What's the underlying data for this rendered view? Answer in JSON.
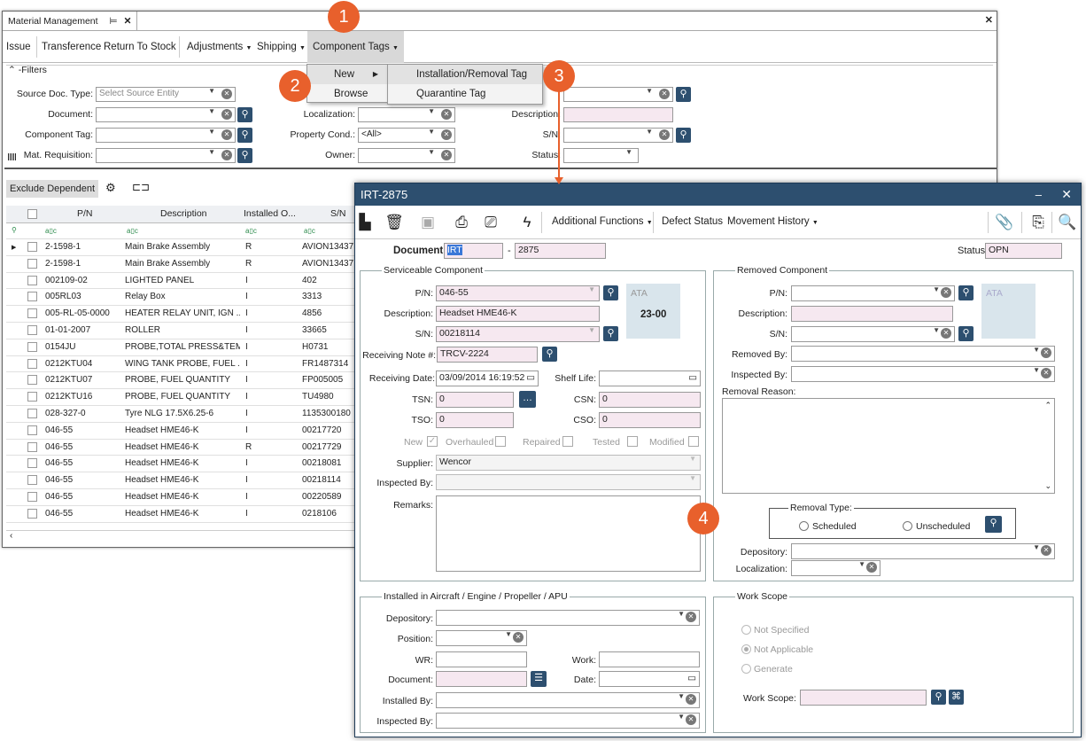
{
  "main_window": {
    "tab_title": "Material Management",
    "menu": [
      "Issue",
      "Transference",
      "Return To Stock",
      "Adjustments",
      "Shipping",
      "Component Tags"
    ],
    "filters_label": "-Filters",
    "filters": {
      "source_doc_type": {
        "label": "Source Doc. Type:",
        "placeholder": "Select Source Entity"
      },
      "document": {
        "label": "Document:"
      },
      "component_tag": {
        "label": "Component Tag:"
      },
      "mat_requisition": {
        "label": "Mat. Requisition:"
      },
      "localization": {
        "label": "Localization:"
      },
      "property_cond": {
        "label": "Property Cond.:",
        "value": "<All>"
      },
      "owner": {
        "label": "Owner:"
      },
      "description": {
        "label": "Description:"
      },
      "sn": {
        "label": "S/N:"
      },
      "status": {
        "label": "Status:"
      }
    },
    "grid_toolbar": {
      "exclude_dependent": "Exclude Dependent"
    },
    "grid": {
      "columns": [
        "P/N",
        "Description",
        "Installed O...",
        "S/N"
      ],
      "filter_glyph": "a▯c",
      "rows": [
        {
          "pn": "2-1598-1",
          "desc": "Main Brake Assembly",
          "inst": "R",
          "sn": "AVION13437"
        },
        {
          "pn": "2-1598-1",
          "desc": "Main Brake Assembly",
          "inst": "R",
          "sn": "AVION13437"
        },
        {
          "pn": "002109-02",
          "desc": "LIGHTED PANEL",
          "inst": "I",
          "sn": "402"
        },
        {
          "pn": "005RL03",
          "desc": "Relay Box",
          "inst": "I",
          "sn": "3313"
        },
        {
          "pn": "005-RL-05-0000",
          "desc": "HEATER RELAY UNIT, IGN ...",
          "inst": "I",
          "sn": "4856"
        },
        {
          "pn": "01-01-2007",
          "desc": "ROLLER",
          "inst": "I",
          "sn": "33665"
        },
        {
          "pn": "0154JU",
          "desc": "PROBE,TOTAL PRESS&TEMP",
          "inst": "I",
          "sn": "H0731"
        },
        {
          "pn": "0212KTU04",
          "desc": "WING TANK PROBE, FUEL ...",
          "inst": "I",
          "sn": "FR1487314"
        },
        {
          "pn": "0212KTU07",
          "desc": "PROBE, FUEL QUANTITY",
          "inst": "I",
          "sn": "FP005005"
        },
        {
          "pn": "0212KTU16",
          "desc": "PROBE, FUEL QUANTITY",
          "inst": "I",
          "sn": "TU4980"
        },
        {
          "pn": "028-327-0",
          "desc": "Tyre NLG 17.5X6.25-6",
          "inst": "I",
          "sn": "1135300180"
        },
        {
          "pn": "046-55",
          "desc": "Headset HME46-K",
          "inst": "I",
          "sn": "00217720"
        },
        {
          "pn": "046-55",
          "desc": "Headset HME46-K",
          "inst": "R",
          "sn": "00217729"
        },
        {
          "pn": "046-55",
          "desc": "Headset HME46-K",
          "inst": "I",
          "sn": "00218081"
        },
        {
          "pn": "046-55",
          "desc": "Headset HME46-K",
          "inst": "I",
          "sn": "00218114"
        },
        {
          "pn": "046-55",
          "desc": "Headset HME46-K",
          "inst": "I",
          "sn": "00220589"
        },
        {
          "pn": "046-55",
          "desc": "Headset HME46-K",
          "inst": "I",
          "sn": "0218106"
        }
      ]
    }
  },
  "dropdown": {
    "items": [
      "New",
      "Browse"
    ],
    "submenu": [
      "Installation/Removal Tag",
      "Quarantine Tag"
    ]
  },
  "callouts": [
    "1",
    "2",
    "3",
    "4"
  ],
  "dialog": {
    "title": "IRT-2875",
    "toolbar": {
      "additional_functions": "Additional Functions",
      "defect_status": "Defect Status",
      "movement_history": "Movement History"
    },
    "document_label": "Document:",
    "document_prefix": "IRT",
    "document_dash": "-",
    "document_number": "2875",
    "status_label": "Status:",
    "status_value": "OPN",
    "serviceable": {
      "legend": "Serviceable Component",
      "pn_label": "P/N:",
      "pn": "046-55",
      "ata_label": "ATA",
      "ata": "23-00",
      "desc_label": "Description:",
      "desc": "Headset HME46-K",
      "sn_label": "S/N:",
      "sn": "00218114",
      "receiving_note_label": "Receiving Note #:",
      "receiving_note": "TRCV-2224",
      "receiving_date_label": "Receiving Date:",
      "receiving_date": "03/09/2014 16:19:52",
      "shelf_life_label": "Shelf Life:",
      "tsn_label": "TSN:",
      "tsn": "0",
      "csn_label": "CSN:",
      "csn": "0",
      "tso_label": "TSO:",
      "tso": "0",
      "cso_label": "CSO:",
      "cso": "0",
      "checks": [
        "New",
        "Overhauled",
        "Repaired",
        "Tested",
        "Modified"
      ],
      "supplier_label": "Supplier:",
      "supplier": "Wencor",
      "inspected_by_label": "Inspected By:",
      "remarks_label": "Remarks:"
    },
    "removed": {
      "legend": "Removed Component",
      "pn_label": "P/N:",
      "ata_label": "ATA",
      "desc_label": "Description:",
      "sn_label": "S/N:",
      "removed_by_label": "Removed By:",
      "inspected_by_label": "Inspected By:",
      "removal_reason_label": "Removal Reason:",
      "removal_type_legend": "Removal Type:",
      "scheduled": "Scheduled",
      "unscheduled": "Unscheduled",
      "depository_label": "Depository:",
      "localization_label": "Localization:"
    },
    "installed": {
      "legend": "Installed in Aircraft / Engine / Propeller / APU",
      "depository_label": "Depository:",
      "position_label": "Position:",
      "wr_label": "WR:",
      "work_label": "Work:",
      "document_label": "Document:",
      "date_label": "Date:",
      "installed_by_label": "Installed By:",
      "inspected_by_label": "Inspected By:"
    },
    "work_scope": {
      "legend": "Work Scope",
      "options": [
        "Not Specified",
        "Not Applicable",
        "Generate"
      ],
      "work_scope_label": "Work Scope:"
    }
  }
}
